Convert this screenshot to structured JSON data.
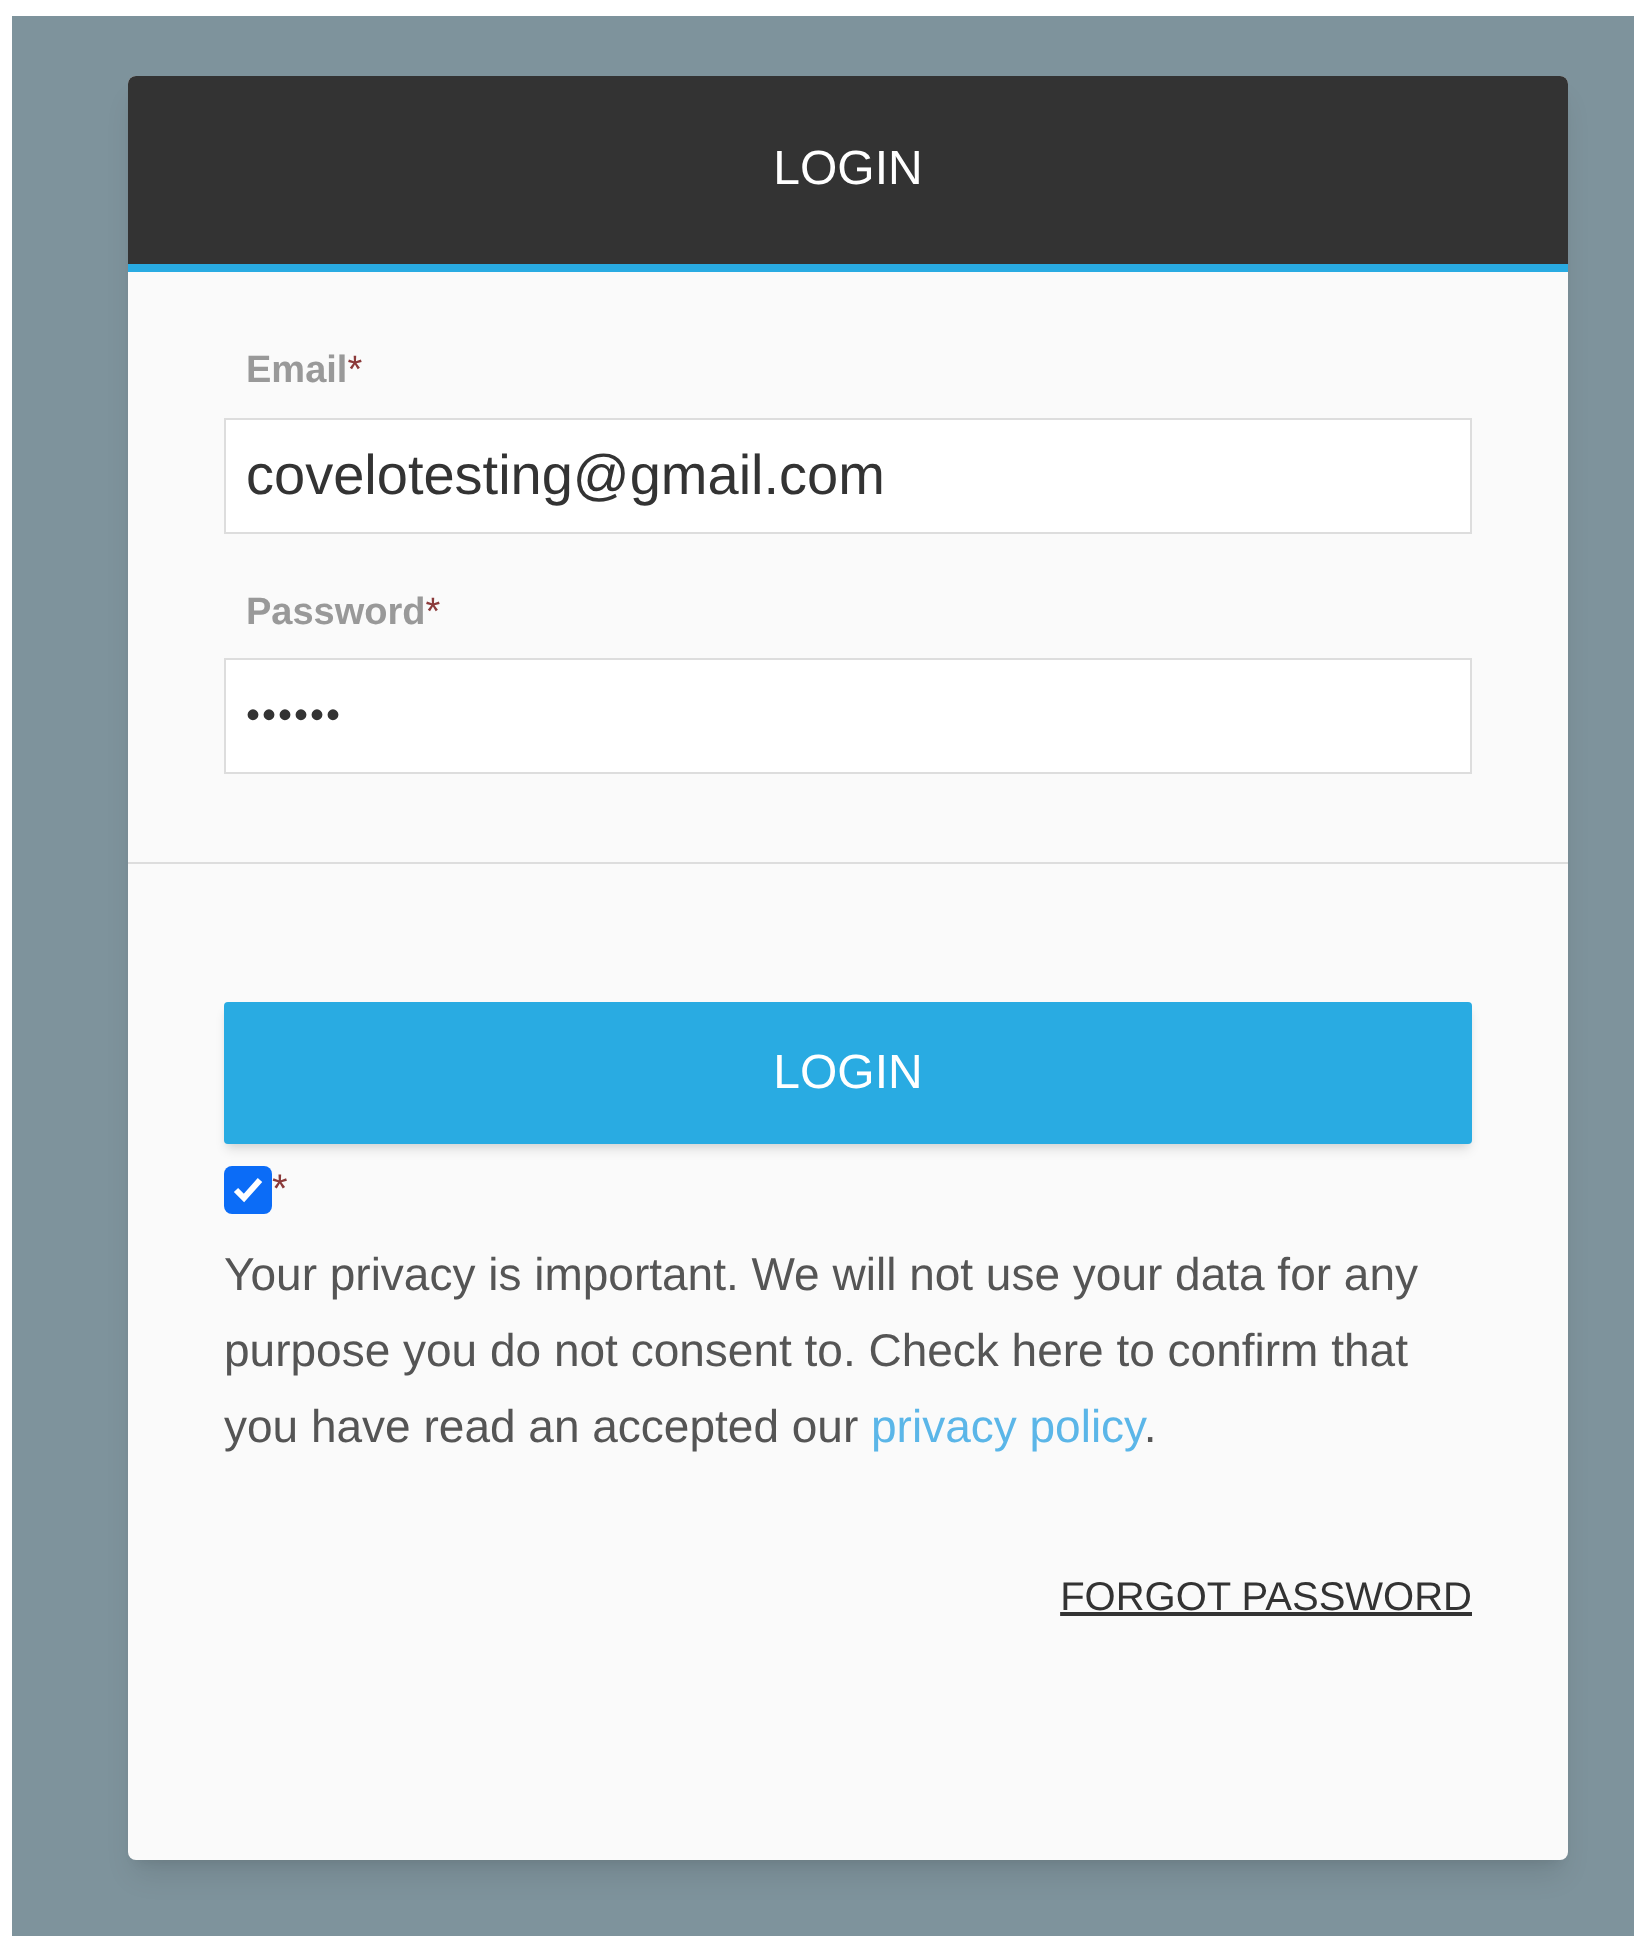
{
  "header": {
    "title": "LOGIN"
  },
  "fields": [
    {
      "label": "Email",
      "required_mark": "*",
      "value": "covelotesting@gmail.com",
      "kind": "text"
    },
    {
      "label": "Password",
      "required_mark": "*",
      "value": "••••••",
      "kind": "password"
    }
  ],
  "login_button": "LOGIN",
  "consent": {
    "checked": true,
    "required_mark": "*",
    "text": "Your privacy is important. We will not use your data for any purpose you do not consent to. Check here to confirm that you have read an accepted our",
    "link": "privacy policy",
    "after_link": "."
  },
  "forgot_password": "FORGOT PASSWORD"
}
